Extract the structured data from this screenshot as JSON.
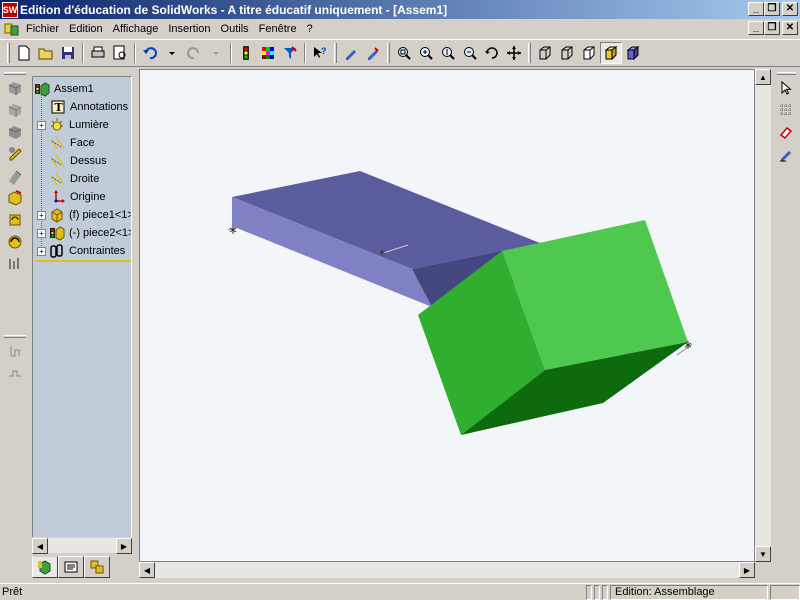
{
  "window": {
    "title": "Edition d'éducation de SolidWorks - A titre éducatif uniquement - [Assem1]",
    "app_icon_label": "SW",
    "buttons": {
      "minimize": "_",
      "restore": "❐",
      "close": "✕"
    }
  },
  "menu": {
    "items": [
      "Fichier",
      "Edition",
      "Affichage",
      "Insertion",
      "Outils",
      "Fenêtre",
      "?"
    ]
  },
  "toolbar": {
    "icons": [
      "new-icon",
      "open-icon",
      "save-icon",
      "print-icon",
      "print-preview-icon",
      "undo-icon",
      "redo-icon",
      "traffic-light-icon",
      "color-grid-icon",
      "filter-icon",
      "help-pointer-icon",
      "sketch-pencil-icon",
      "smart-mate-icon",
      "zoom-fit-icon",
      "zoom-area-icon",
      "zoom-in-out-icon",
      "zoom-selection-icon",
      "rotate-view-icon",
      "pan-icon",
      "wireframe-icon",
      "hidden-lines-icon",
      "hidden-removed-icon",
      "shaded-icon",
      "shaded-edges-icon"
    ]
  },
  "tree": {
    "root": "Assem1",
    "items": [
      {
        "label": "Annotations",
        "icon": "annotation-icon",
        "expandable": false
      },
      {
        "label": "Lumière",
        "icon": "lighting-icon",
        "expandable": true
      },
      {
        "label": "Face",
        "icon": "plane-icon",
        "expandable": false
      },
      {
        "label": "Dessus",
        "icon": "plane-icon",
        "expandable": false
      },
      {
        "label": "Droite",
        "icon": "plane-icon",
        "expandable": false
      },
      {
        "label": "Origine",
        "icon": "origin-icon",
        "expandable": false
      },
      {
        "label": "(f) piece1<1>",
        "icon": "part-icon",
        "expandable": true
      },
      {
        "label": "(-) piece2<1>",
        "icon": "part-icon",
        "expandable": true
      },
      {
        "label": "Contraintes",
        "icon": "mates-icon",
        "expandable": true
      }
    ]
  },
  "panel_tabs": [
    "feature-manager-tab",
    "property-manager-tab",
    "configuration-manager-tab"
  ],
  "status": {
    "left": "Prêt",
    "mode": "Edition: Assemblage"
  },
  "colors": {
    "title_start": "#0a246a",
    "title_end": "#a6caf0",
    "tree_bg": "#c0cdd8",
    "viewport_bg": "#f3f6f8",
    "bar_top": "#5b5c9e",
    "bar_front": "#8081c4",
    "bar_side": "#444680",
    "cube_top": "#4fc84f",
    "cube_front": "#2fae2f",
    "cube_bottom": "#0d6a0d"
  }
}
